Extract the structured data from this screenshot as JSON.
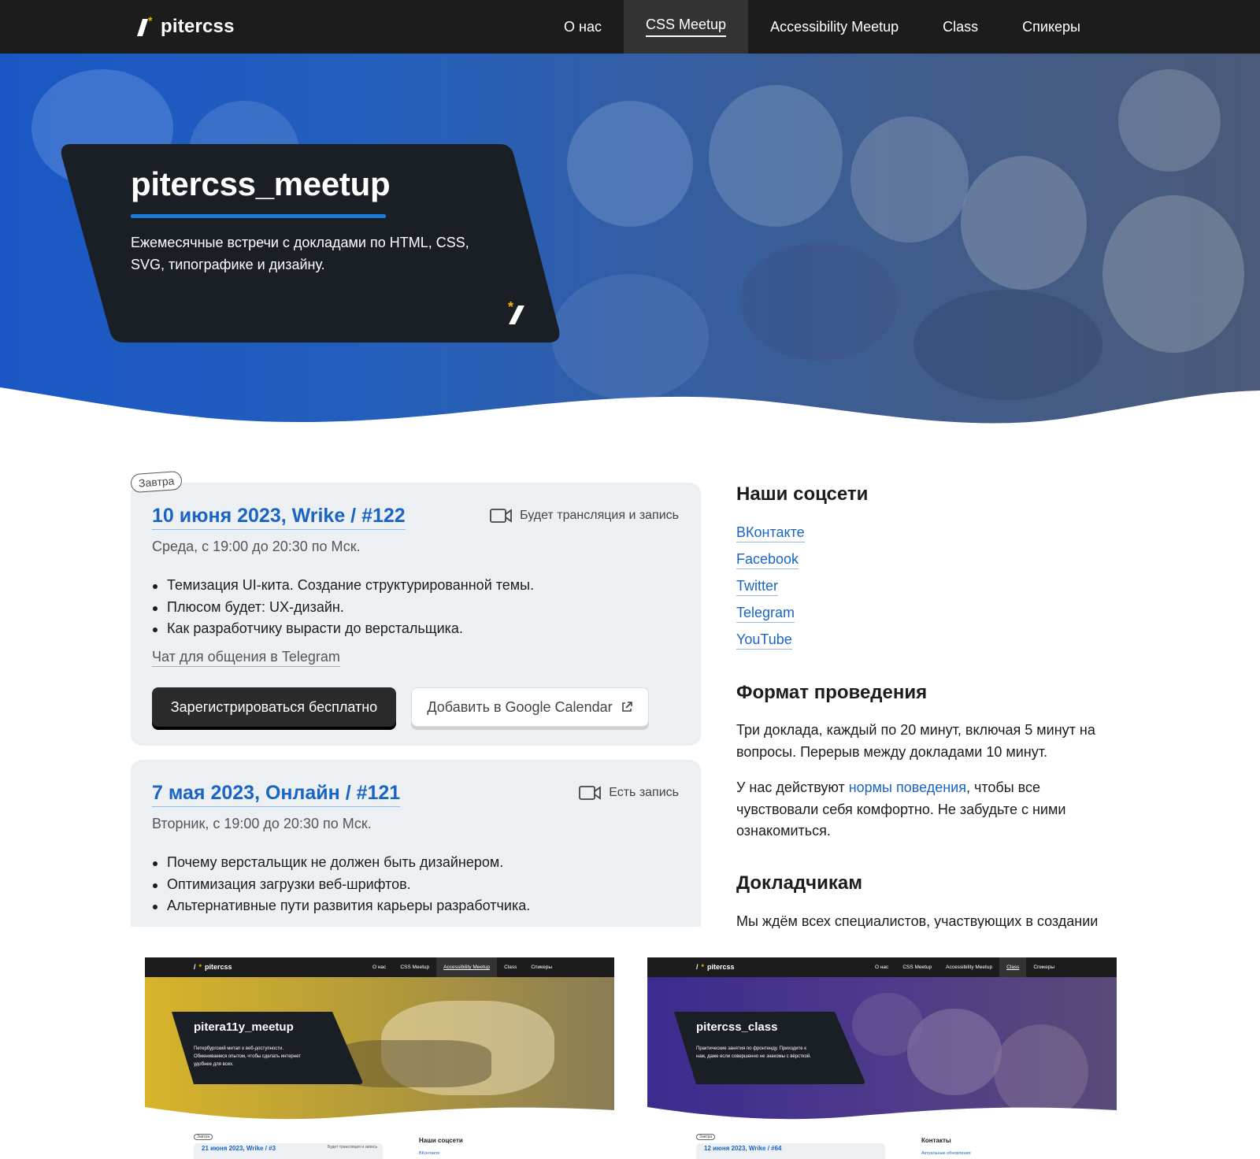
{
  "header": {
    "logo_text": "pitercss",
    "nav": [
      {
        "label": "О нас",
        "active": false
      },
      {
        "label": "CSS Meetup",
        "active": true
      },
      {
        "label": "Accessibility Meetup",
        "active": false
      },
      {
        "label": "Class",
        "active": false
      },
      {
        "label": "Спикеры",
        "active": false
      }
    ]
  },
  "hero": {
    "title": "pitercss_meetup",
    "description": "Ежемесячные встречи с докладами по HTML, CSS, SVG, типографике и дизайну."
  },
  "events": [
    {
      "badge": "Завтра",
      "title": "10 июня 2023, Wrike / #122",
      "time": "Среда, с 19:00 до 20:30 по Мск.",
      "recording": "Будет трансляция и запись",
      "talks": [
        "Темизация UI-кита. Создание структурированной темы.",
        "Плюсом будет: UX-дизайн.",
        "Как разработчику вырасти до верстальщика."
      ],
      "chat_link": "Чат для общения в Telegram",
      "register_button": "Зарегистрироваться бесплатно",
      "calendar_button": "Добавить в Google Calendar"
    },
    {
      "title": "7 мая 2023, Онлайн / #121",
      "time": "Вторник, с 19:00 до 20:30 по Мск.",
      "recording": "Есть запись",
      "talks": [
        "Почему верстальщик не должен быть дизайнером.",
        "Оптимизация загрузки веб-шрифтов.",
        "Альтернативные пути развития карьеры разработчика."
      ]
    }
  ],
  "sidebar": {
    "social_heading": "Наши соцсети",
    "social_links": [
      "ВКонтакте",
      "Facebook",
      "Twitter",
      "Telegram",
      "YouTube"
    ],
    "format_heading": "Формат проведения",
    "format_text": "Три доклада, каждый по 20 минут, включая 5 минут на вопросы. Перерыв между докладами 10 минут.",
    "conduct_before": "У нас действуют ",
    "conduct_link": "нормы поведения",
    "conduct_after": ", чтобы все чувствовали себя комфортно. Не забудьте с ними ознакомиться.",
    "speakers_heading": "Докладчикам",
    "speakers_text": "Мы ждём всех специалистов, участвующих в создании"
  },
  "previews": [
    {
      "logo_text": "pitercss",
      "nav": [
        "О нас",
        "CSS Meetup",
        "Accessibility Meetup",
        "Class",
        "Спикеры"
      ],
      "active": "Accessibility Meetup",
      "title": "pitera11y_meetup",
      "description": "Петербургский митап о веб-доступности. Обмениваемся опытом, чтобы сделать интернет удобнее для всех.",
      "badge": "Завтра",
      "event_title": "21 июня 2023, Wrike / #3",
      "event_recording": "Будет трансляция и запись",
      "side_heading": "Наши соцсети",
      "side_sub": "ВКонтакте",
      "tint": "#c9a41e"
    },
    {
      "logo_text": "pitercss",
      "nav": [
        "О нас",
        "CSS Meetup",
        "Accessibility Meetup",
        "Class",
        "Спикеры"
      ],
      "active": "Class",
      "title": "pitercss_class",
      "description": "Практические занятия по фронтенду. Приходите к нам, даже если совершенно не знакомы с вёрсткой.",
      "badge": "Завтра",
      "event_title": "12 июня 2023, Wrike / #64",
      "event_recording": "",
      "side_heading": "Контакты",
      "side_sub": "Актуальные обновления",
      "tint": "#4a2e9c"
    }
  ],
  "colors": {
    "accent": "#1a65c4",
    "dark": "#1c1c1c",
    "star": "#f5b400"
  }
}
